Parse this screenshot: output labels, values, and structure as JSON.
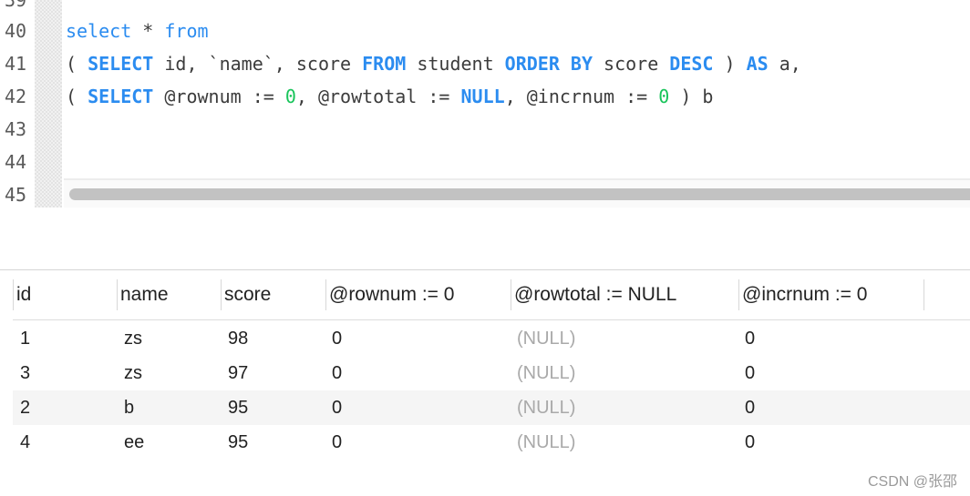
{
  "editor": {
    "line_numbers": [
      "39",
      "40",
      "41",
      "42",
      "43",
      "44",
      "45"
    ],
    "lines": {
      "l40": {
        "kw1": "select",
        "op": " * ",
        "kw2": "from"
      },
      "l41": {
        "open": "( ",
        "kw_select": "SELECT",
        "cols": " id, `name`, score ",
        "kw_from": "FROM",
        "tbl": " student ",
        "kw_order": "ORDER BY",
        "col": " score ",
        "kw_desc": "DESC",
        "close": " ) ",
        "kw_as": "AS",
        "alias": " a,"
      },
      "l42": {
        "open": "( ",
        "kw_select": "SELECT",
        "v1": " @rownum := ",
        "n1": "0",
        "v2": ", @rowtotal := ",
        "kw_null": "NULL",
        "v3": ", @incrnum := ",
        "n2": "0",
        "close": " ) b"
      }
    }
  },
  "results": {
    "columns": [
      "id",
      "name",
      "score",
      "@rownum := 0",
      "@rowtotal := NULL",
      "@incrnum := 0"
    ],
    "rows": [
      [
        "1",
        "zs",
        "98",
        "0",
        "(NULL)",
        "0"
      ],
      [
        "3",
        "zs",
        "97",
        "0",
        "(NULL)",
        "0"
      ],
      [
        "2",
        "b",
        "95",
        "0",
        "(NULL)",
        "0"
      ],
      [
        "4",
        "ee",
        "95",
        "0",
        "(NULL)",
        "0"
      ]
    ]
  },
  "watermark": "CSDN @张邵"
}
